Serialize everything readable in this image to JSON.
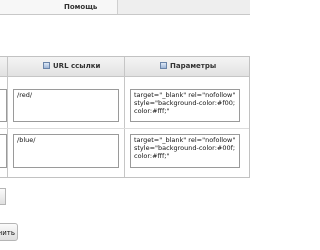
{
  "tabs": {
    "help": "Помощь"
  },
  "table": {
    "columns": [
      "URL ссылки",
      "Параметры"
    ],
    "rows": [
      {
        "url": "/red/",
        "params": "target=\"_blank\" rel=\"nofollow\" style=\"background-color:#f00; color:#fff;\""
      },
      {
        "url": "/blue/",
        "params": "target=\"_blank\" rel=\"nofollow\" style=\"background-color:#00f; color:#fff;\""
      }
    ]
  },
  "footer": {
    "button_label": "нить"
  }
}
